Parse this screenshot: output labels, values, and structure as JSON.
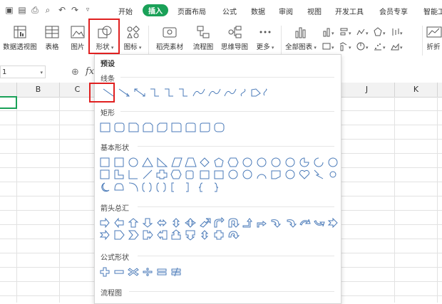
{
  "menu": {
    "items": [
      "开始",
      "插入",
      "页面布局",
      "公式",
      "数据",
      "审阅",
      "视图",
      "开发工具",
      "会员专享",
      "智能工"
    ],
    "active_index": 1
  },
  "ribbon": {
    "buttons": [
      "数据透视图",
      "表格",
      "图片",
      "形状",
      "图标",
      "稻壳素材",
      "流程图",
      "思维导图",
      "更多",
      "全部图表",
      "折折"
    ]
  },
  "namebox": {
    "value": "1"
  },
  "formula": {
    "fx": "fx"
  },
  "columns": [
    "B",
    "C",
    "J",
    "K"
  ],
  "shapes_panel": {
    "title": "预设",
    "sections": [
      "线条",
      "矩形",
      "基本形状",
      "箭头总汇",
      "公式形状",
      "流程图"
    ]
  },
  "colors": {
    "accent": "#1aa158",
    "highlight": "#e02020",
    "shape_stroke": "#4a7ab8"
  },
  "icons": [
    "save-icon",
    "print-icon",
    "undo-icon",
    "redo-icon",
    "fx-icon"
  ]
}
